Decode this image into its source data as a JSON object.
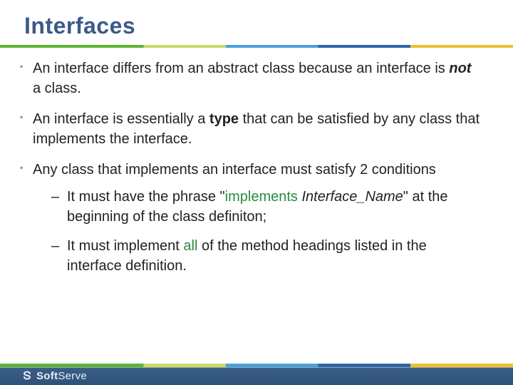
{
  "title": "Interfaces",
  "bullets": {
    "b1_a": "An interface differs from an abstract class because an interface is ",
    "b1_not": "not",
    "b1_b": " a class.",
    "b2_a": "An interface is essentially a ",
    "b2_type": "type",
    "b2_b": " that can be satisfied by any class that implements the interface.",
    "b3": "Any class that implements an interface must satisfy 2 conditions",
    "s1_a": "It must have the phrase \"",
    "s1_kw": "implements",
    "s1_sp": " ",
    "s1_iname": "Interface_Name",
    "s1_b": "\" at the beginning of the class definiton;",
    "s2_a": "It must implement ",
    "s2_all": "all",
    "s2_b": " of the method headings listed in the interface definition."
  },
  "footer": {
    "brand_a": "Soft",
    "brand_b": "Serve"
  }
}
